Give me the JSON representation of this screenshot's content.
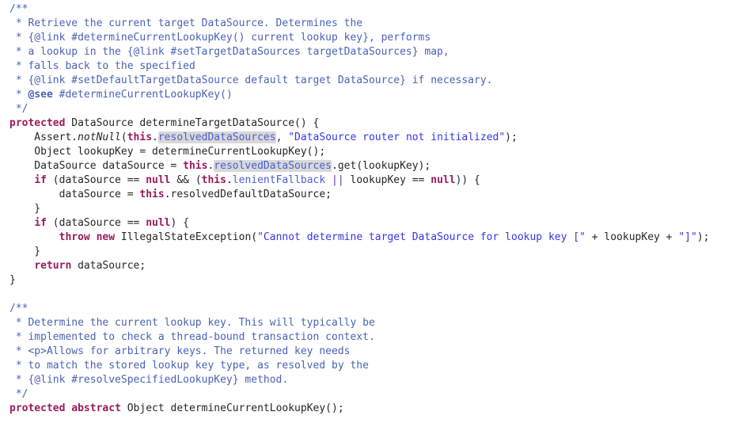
{
  "editor": {
    "language": "Java",
    "background_color": "#ffffff",
    "font_size_px": 13,
    "line_height_px": 18,
    "occurrence_highlight_color": "#d8d8d8",
    "colors": {
      "comment": "#4a63b5",
      "keyword": "#9b1a5c",
      "string": "#3a33e8",
      "field": "#4a5fd0",
      "operator": "#6b2fa8",
      "plain": "#262626"
    }
  },
  "code": {
    "lines": [
      {
        "indent": 0,
        "tokens": [
          {
            "t": "comment",
            "v": "/**"
          }
        ]
      },
      {
        "indent": 0,
        "tokens": [
          {
            "t": "comment",
            "v": " * Retrieve the current target DataSource. Determines the"
          }
        ]
      },
      {
        "indent": 0,
        "tokens": [
          {
            "t": "comment",
            "v": " * {@link #determineCurrentLookupKey() current lookup key}, performs"
          }
        ]
      },
      {
        "indent": 0,
        "tokens": [
          {
            "t": "comment",
            "v": " * a lookup in the {@link #setTargetDataSources targetDataSources} map,"
          }
        ]
      },
      {
        "indent": 0,
        "tokens": [
          {
            "t": "comment",
            "v": " * falls back to the specified"
          }
        ]
      },
      {
        "indent": 0,
        "tokens": [
          {
            "t": "comment",
            "v": " * {@link #setDefaultTargetDataSource default target DataSource} if necessary."
          }
        ]
      },
      {
        "indent": 0,
        "tokens": [
          {
            "t": "comment",
            "v": " * "
          },
          {
            "t": "tag",
            "v": "@see"
          },
          {
            "t": "comment",
            "v": " #determineCurrentLookupKey()"
          }
        ]
      },
      {
        "indent": 0,
        "tokens": [
          {
            "t": "comment",
            "v": " */"
          }
        ]
      },
      {
        "indent": 0,
        "tokens": [
          {
            "t": "keyword",
            "v": "protected"
          },
          {
            "t": "plain",
            "v": " DataSource determineTargetDataSource() {"
          }
        ]
      },
      {
        "indent": 0,
        "tokens": [
          {
            "t": "plain",
            "v": "    Assert."
          },
          {
            "t": "static",
            "v": "notNull"
          },
          {
            "t": "punct",
            "v": "("
          },
          {
            "t": "keyword",
            "v": "this"
          },
          {
            "t": "punct",
            "v": "."
          },
          {
            "t": "occurrence",
            "v": "resolvedDataSources"
          },
          {
            "t": "plain",
            "v": ", "
          },
          {
            "t": "string",
            "v": "\"DataSource router not initialized\""
          },
          {
            "t": "plain",
            "v": ");"
          }
        ]
      },
      {
        "indent": 0,
        "tokens": [
          {
            "t": "plain",
            "v": "    Object lookupKey = determineCurrentLookupKey();"
          }
        ]
      },
      {
        "indent": 0,
        "tokens": [
          {
            "t": "plain",
            "v": "    DataSource dataSource = "
          },
          {
            "t": "keyword",
            "v": "this"
          },
          {
            "t": "punct",
            "v": "."
          },
          {
            "t": "occurrence",
            "v": "resolvedDataSources"
          },
          {
            "t": "plain",
            "v": ".get(lookupKey);"
          }
        ]
      },
      {
        "indent": 0,
        "tokens": [
          {
            "t": "plain",
            "v": "    "
          },
          {
            "t": "keyword",
            "v": "if"
          },
          {
            "t": "plain",
            "v": " (dataSource == "
          },
          {
            "t": "keyword",
            "v": "null"
          },
          {
            "t": "plain",
            "v": " && ("
          },
          {
            "t": "keyword",
            "v": "this"
          },
          {
            "t": "punct",
            "v": "."
          },
          {
            "t": "field",
            "v": "lenientFallback"
          },
          {
            "t": "plain",
            "v": " "
          },
          {
            "t": "operator",
            "v": "||"
          },
          {
            "t": "plain",
            "v": " lookupKey == "
          },
          {
            "t": "keyword",
            "v": "null"
          },
          {
            "t": "plain",
            "v": ")) {"
          }
        ]
      },
      {
        "indent": 0,
        "tokens": [
          {
            "t": "plain",
            "v": "        dataSource = "
          },
          {
            "t": "keyword",
            "v": "this"
          },
          {
            "t": "plain",
            "v": ".resolvedDefaultDataSource;"
          }
        ]
      },
      {
        "indent": 0,
        "tokens": [
          {
            "t": "plain",
            "v": "    }"
          }
        ]
      },
      {
        "indent": 0,
        "tokens": [
          {
            "t": "plain",
            "v": "    "
          },
          {
            "t": "keyword",
            "v": "if"
          },
          {
            "t": "plain",
            "v": " (dataSource == "
          },
          {
            "t": "keyword",
            "v": "null"
          },
          {
            "t": "plain",
            "v": ") {"
          }
        ]
      },
      {
        "indent": 0,
        "tokens": [
          {
            "t": "plain",
            "v": "        "
          },
          {
            "t": "keyword",
            "v": "throw"
          },
          {
            "t": "plain",
            "v": " "
          },
          {
            "t": "keyword",
            "v": "new"
          },
          {
            "t": "plain",
            "v": " IllegalStateException("
          },
          {
            "t": "string",
            "v": "\"Cannot determine target DataSource for lookup key [\""
          },
          {
            "t": "plain",
            "v": " + lookupKey + "
          },
          {
            "t": "string",
            "v": "\"]\""
          },
          {
            "t": "plain",
            "v": ");"
          }
        ]
      },
      {
        "indent": 0,
        "tokens": [
          {
            "t": "plain",
            "v": "    }"
          }
        ]
      },
      {
        "indent": 0,
        "tokens": [
          {
            "t": "plain",
            "v": "    "
          },
          {
            "t": "keyword",
            "v": "return"
          },
          {
            "t": "plain",
            "v": " dataSource;"
          }
        ]
      },
      {
        "indent": 0,
        "tokens": [
          {
            "t": "plain",
            "v": "}"
          }
        ]
      },
      {
        "indent": 0,
        "tokens": [
          {
            "t": "plain",
            "v": ""
          }
        ]
      },
      {
        "indent": 0,
        "tokens": [
          {
            "t": "comment",
            "v": "/**"
          }
        ]
      },
      {
        "indent": 0,
        "tokens": [
          {
            "t": "comment",
            "v": " * Determine the current lookup key. This will typically be"
          }
        ]
      },
      {
        "indent": 0,
        "tokens": [
          {
            "t": "comment",
            "v": " * implemented to check a thread-bound transaction context."
          }
        ]
      },
      {
        "indent": 0,
        "tokens": [
          {
            "t": "comment",
            "v": " * <p>Allows for arbitrary keys. The returned key needs"
          }
        ]
      },
      {
        "indent": 0,
        "tokens": [
          {
            "t": "comment",
            "v": " * to match the stored lookup key type, as resolved by the"
          }
        ]
      },
      {
        "indent": 0,
        "tokens": [
          {
            "t": "comment",
            "v": " * {@link #resolveSpecifiedLookupKey} method."
          }
        ]
      },
      {
        "indent": 0,
        "tokens": [
          {
            "t": "comment",
            "v": " */"
          }
        ]
      },
      {
        "indent": 0,
        "tokens": [
          {
            "t": "keyword",
            "v": "protected"
          },
          {
            "t": "plain",
            "v": " "
          },
          {
            "t": "keyword",
            "v": "abstract"
          },
          {
            "t": "plain",
            "v": " Object determineCurrentLookupKey();"
          }
        ]
      }
    ]
  }
}
